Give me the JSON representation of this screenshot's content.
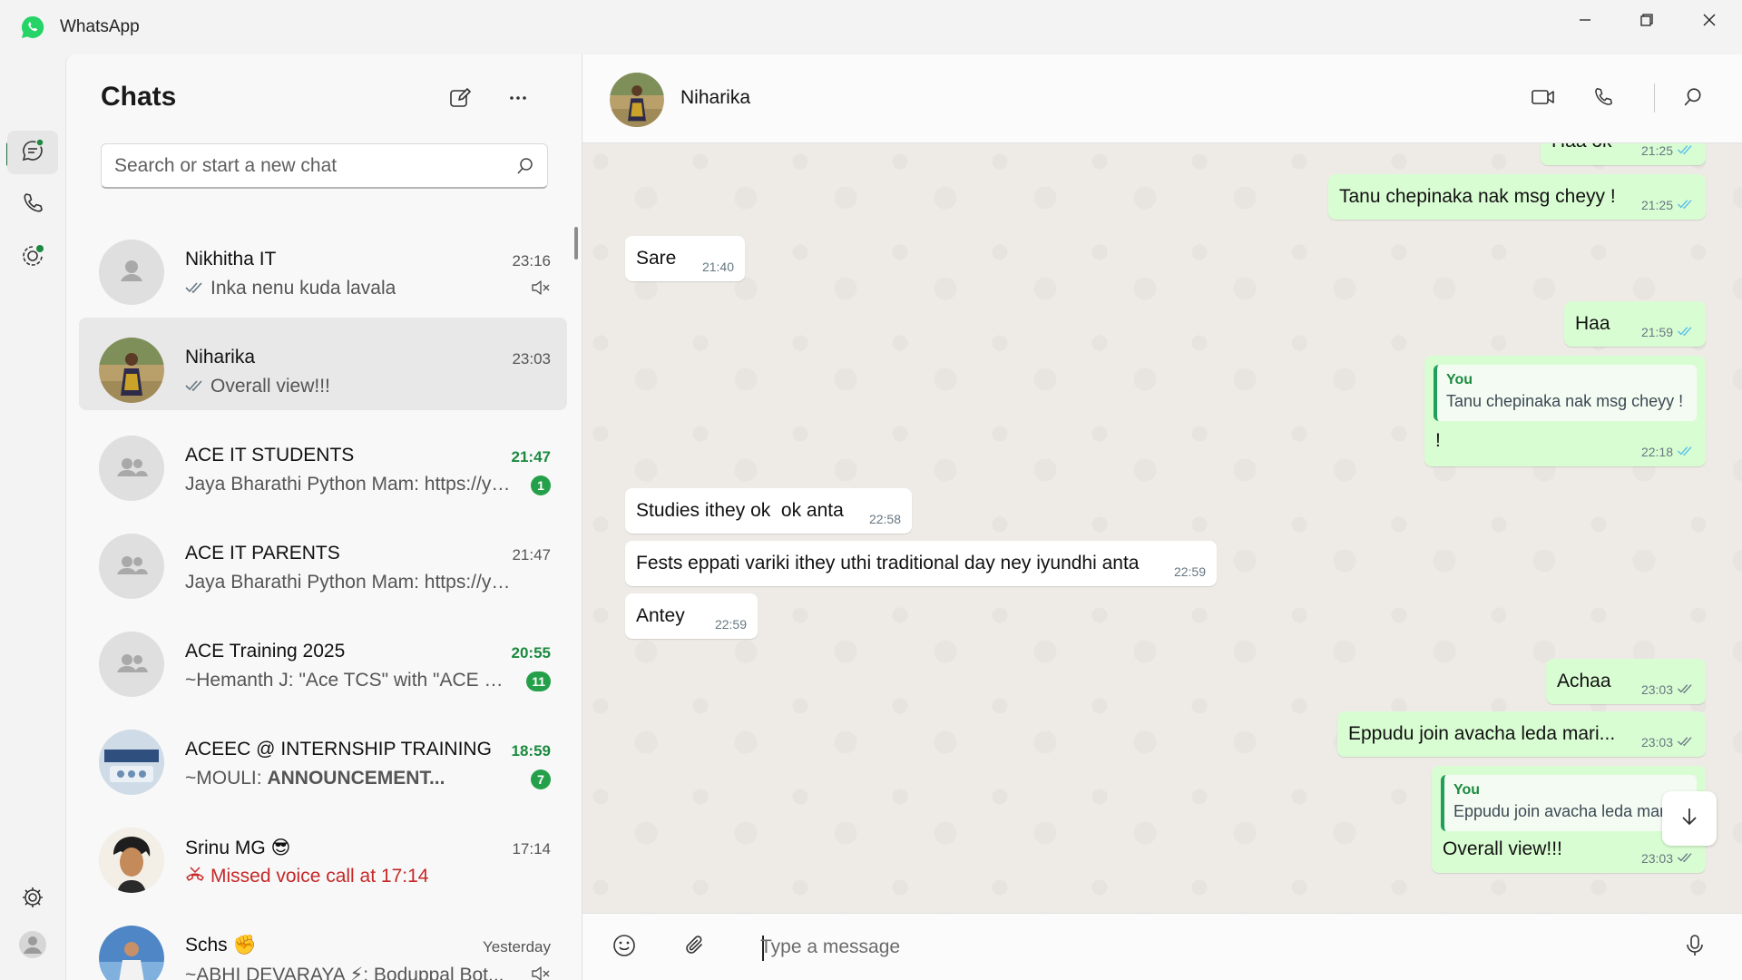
{
  "window": {
    "title": "WhatsApp"
  },
  "rail": {
    "items": [
      "chats-icon",
      "calls-icon",
      "status-icon",
      "settings-icon",
      "profile-icon"
    ]
  },
  "sidebar": {
    "title": "Chats",
    "search_placeholder": "Search or start a new chat",
    "chats": [
      {
        "name": "Nikhitha IT",
        "preview": "Inka nenu kuda lavala",
        "time": "23:16",
        "ticks": "double-gray",
        "muted": true,
        "unread": "",
        "selected": false
      },
      {
        "name": "Niharika",
        "preview": "Overall view!!!",
        "time": "23:03",
        "ticks": "double-gray",
        "muted": false,
        "unread": "",
        "selected": true
      },
      {
        "name": "ACE IT STUDENTS",
        "preview": "Jaya Bharathi Python Mam: https://yo...",
        "time": "21:47",
        "unread": "1",
        "muted": false,
        "selected": false
      },
      {
        "name": "ACE IT PARENTS",
        "preview": "Jaya Bharathi Python Mam: https://you...",
        "time": "21:47",
        "unread": "",
        "muted": false,
        "selected": false
      },
      {
        "name": "ACE Training 2025",
        "preview": "~Hemanth J: \"Ace TCS\" with \"ACE On...",
        "time": "20:55",
        "unread": "11",
        "muted": false,
        "selected": false
      },
      {
        "name": "ACEEC @ INTERNSHIP TRAINING",
        "preview_prefix": "~MOULI: ",
        "preview": "ANNOUNCEMENT...",
        "time": "18:59",
        "unread": "7",
        "muted": false,
        "selected": false
      },
      {
        "name": "Srinu MG 😎",
        "preview": "Missed voice call at 17:14",
        "time": "17:14",
        "unread": "",
        "muted": false,
        "selected": false
      },
      {
        "name": "Schs ✊",
        "preview": "~ABHI DEVARAYA ⚡: Boduppal Bot...",
        "time": "Yesterday",
        "unread": "",
        "muted": true,
        "selected": false
      }
    ]
  },
  "conversation": {
    "contact_name": "Niharika",
    "composer_placeholder": "Type a message",
    "messages": [
      {
        "dir": "out",
        "text": "Haa ok",
        "time": "21:25",
        "status": "read"
      },
      {
        "dir": "out",
        "text": "Tanu chepinaka nak msg cheyy !",
        "time": "21:25",
        "status": "read"
      },
      {
        "dir": "in",
        "text": "Sare",
        "time": "21:40"
      },
      {
        "dir": "out",
        "text": "Haa",
        "time": "21:59",
        "status": "read"
      },
      {
        "dir": "out",
        "quote_author": "You",
        "quote_text": "Tanu chepinaka nak msg cheyy !",
        "text": "!",
        "time": "22:18",
        "status": "read"
      },
      {
        "dir": "in",
        "text": "Studies ithey ok  ok anta",
        "time": "22:58"
      },
      {
        "dir": "in",
        "text": "Fests eppati variki ithey uthi traditional day ney iyundhi anta",
        "time": "22:59"
      },
      {
        "dir": "in",
        "text": "Antey",
        "time": "22:59"
      },
      {
        "dir": "out",
        "text": "Achaa",
        "time": "23:03",
        "status": "delivered"
      },
      {
        "dir": "out",
        "text": "Eppudu join avacha leda mari...",
        "time": "23:03",
        "status": "delivered"
      },
      {
        "dir": "out",
        "quote_author": "You",
        "quote_text": "Eppudu join avacha leda mari...",
        "text": "Overall view!!!",
        "time": "23:03",
        "status": "delivered"
      }
    ]
  },
  "colors": {
    "brand": "#25d366",
    "accent_dark": "#1f6f3d",
    "unread": "#1b8a3e",
    "outgoing_bubble": "#d9fdd3",
    "incoming_bubble": "#ffffff",
    "read_tick": "#53bdeb",
    "missed": "#c62828"
  }
}
